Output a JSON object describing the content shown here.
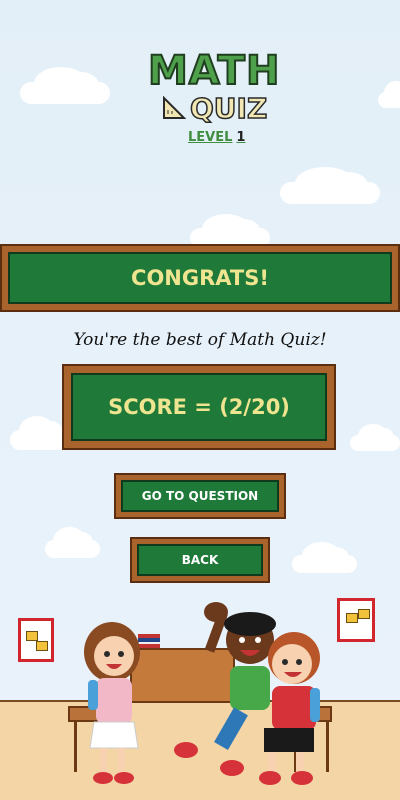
{
  "logo": {
    "title_top": "MATH",
    "title_bottom": "QUIZ",
    "level_label": "LEVEL",
    "level_number": "1"
  },
  "banner": {
    "text": "CONGRATS!"
  },
  "message": "You're the best of Math Quiz!",
  "score": {
    "text": "SCORE = (2/20)"
  },
  "buttons": {
    "go_to_question": "GO TO QUESTION",
    "back": "BACK"
  },
  "colors": {
    "board_green": "#1f7a39",
    "board_frame": "#a8642c",
    "chalk_text": "#efe48f",
    "sky": "#e6f1f9"
  }
}
